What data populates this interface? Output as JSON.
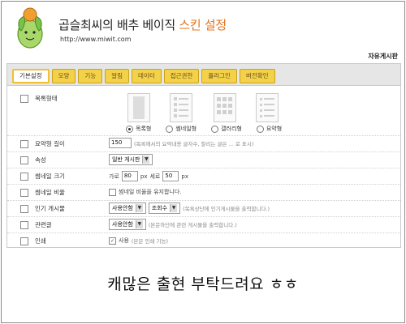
{
  "header": {
    "title_main": "곱슬최씨의 배추 베이직 ",
    "title_accent": "스킨 설정",
    "url": "http://www.miwit.com",
    "admin_link": "자유게시판"
  },
  "tabs": [
    "기본설정",
    "모양",
    "기능",
    "알림",
    "데이터",
    "접근권한",
    "플러그인",
    "버전확인"
  ],
  "rows": {
    "list_type": {
      "label": "목록형태",
      "options": [
        "목록형",
        "썸네일형",
        "갤러리형",
        "요약형"
      ],
      "selected": "목록형"
    },
    "summary_length": {
      "label": "요약형 길이",
      "value": "150",
      "note": "(목록에서의 요약내용 글자수, 잘리는 글은 ... 로 표시)"
    },
    "attribute": {
      "label": "속성",
      "value": "일반 게시판"
    },
    "thumb_size": {
      "label": "썸네일 크기",
      "w_prefix": "가로",
      "w_value": "80",
      "px": "px",
      "h_prefix": "세로",
      "h_value": "50",
      "px2": "px"
    },
    "thumb_ratio": {
      "label": "썸네일 비율",
      "text": "썸네일 비율을 유지합니다."
    },
    "popular": {
      "label": "인기 게시물",
      "select1": "사용안함",
      "select2": "조회수",
      "note": "(목록상단에 인기게시물을 출력합니다.)"
    },
    "related": {
      "label": "관련글",
      "select": "사용안함",
      "note": "(본문하단에 관련 게시물을 출력합니다.)"
    },
    "print": {
      "label": "인쇄",
      "text": "사용",
      "note": "(본문 인쇄 기능)"
    }
  },
  "caption": "캐많은 출현 부탁드려요 ㅎㅎ",
  "colors": {
    "tab_bg": "#f3d24a",
    "accent": "#e4731b"
  }
}
